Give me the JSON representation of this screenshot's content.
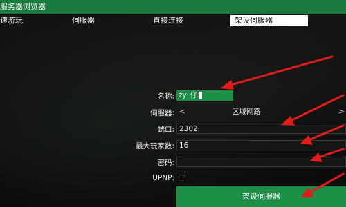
{
  "window": {
    "title": "服务器浏览器"
  },
  "tabs": [
    {
      "label": "速游玩",
      "active": false
    },
    {
      "label": "伺服器",
      "active": false
    },
    {
      "label": "直接连接",
      "active": false
    },
    {
      "label": "架设伺服器",
      "active": true
    }
  ],
  "form": {
    "name_label": "名称:",
    "name_value": "zy_仔",
    "server_label": "伺服器:",
    "server_value": "区域网路",
    "server_prev_icon": "chevron-left-icon",
    "server_next_icon": "chevron-right-icon",
    "port_label": "端口:",
    "port_value": "2302",
    "max_players_label": "最大玩家数:",
    "max_players_value": "16",
    "password_label": "密码:",
    "password_value": "",
    "upnp_label": "UPNP:",
    "upnp_checked": false,
    "host_button": "架设伺服器"
  },
  "annotations": {
    "arrow_color": "#e21b1b"
  },
  "colors": {
    "accent": "#1c8f47",
    "titlebar": "#1a7a3d"
  }
}
